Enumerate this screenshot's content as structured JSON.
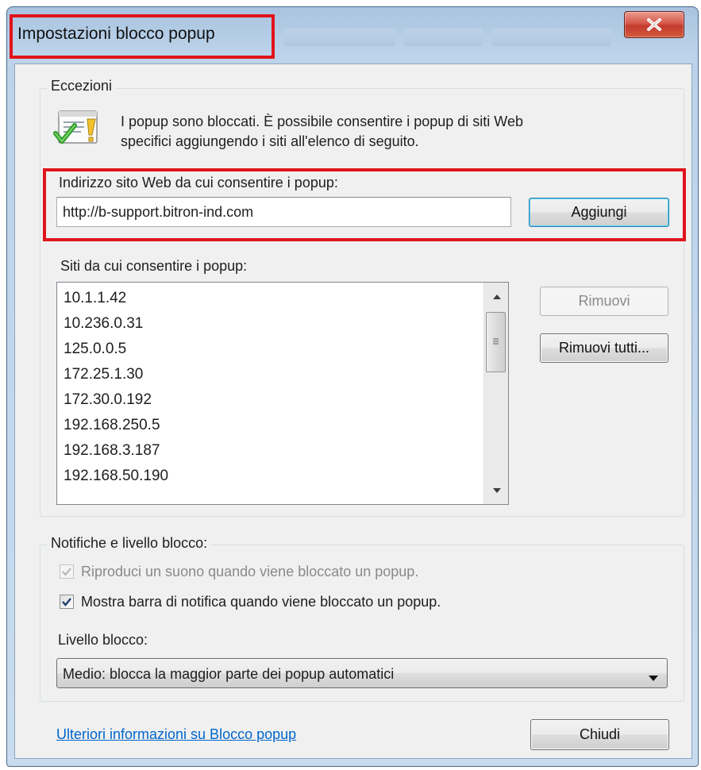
{
  "window": {
    "title": "Impostazioni blocco popup"
  },
  "exceptions": {
    "group_label": "Eccezioni",
    "info_line1": "I popup sono bloccati. È possibile consentire i popup di siti Web",
    "info_line2": "specifici aggiungendo i siti all'elenco di seguito.",
    "address_label": "Indirizzo sito Web da cui consentire i popup:",
    "address_value": "http://b-support.bitron-ind.com",
    "add_button": "Aggiungi",
    "allowed_label": "Siti da cui consentire i popup:",
    "allowed_sites": [
      "10.1.1.42",
      "10.236.0.31",
      "125.0.0.5",
      "172.25.1.30",
      "172.30.0.192",
      "192.168.250.5",
      "192.168.3.187",
      "192.168.50.190"
    ],
    "remove_button": "Rimuovi",
    "remove_all_button": "Rimuovi tutti..."
  },
  "notifications": {
    "group_label": "Notifiche e livello blocco:",
    "play_sound_label": "Riproduci un suono quando viene bloccato un popup.",
    "play_sound_checked": true,
    "play_sound_enabled": false,
    "show_bar_label": "Mostra barra di notifica quando viene bloccato un popup.",
    "show_bar_checked": true,
    "level_label": "Livello blocco:",
    "level_value": "Medio: blocca la maggior parte dei popup automatici"
  },
  "footer": {
    "help_link": "Ulteriori informazioni su Blocco popup",
    "close_button": "Chiudi"
  },
  "colors": {
    "highlight": "#e0141b",
    "link": "#0066cc",
    "close_button": "#c33a2b"
  }
}
